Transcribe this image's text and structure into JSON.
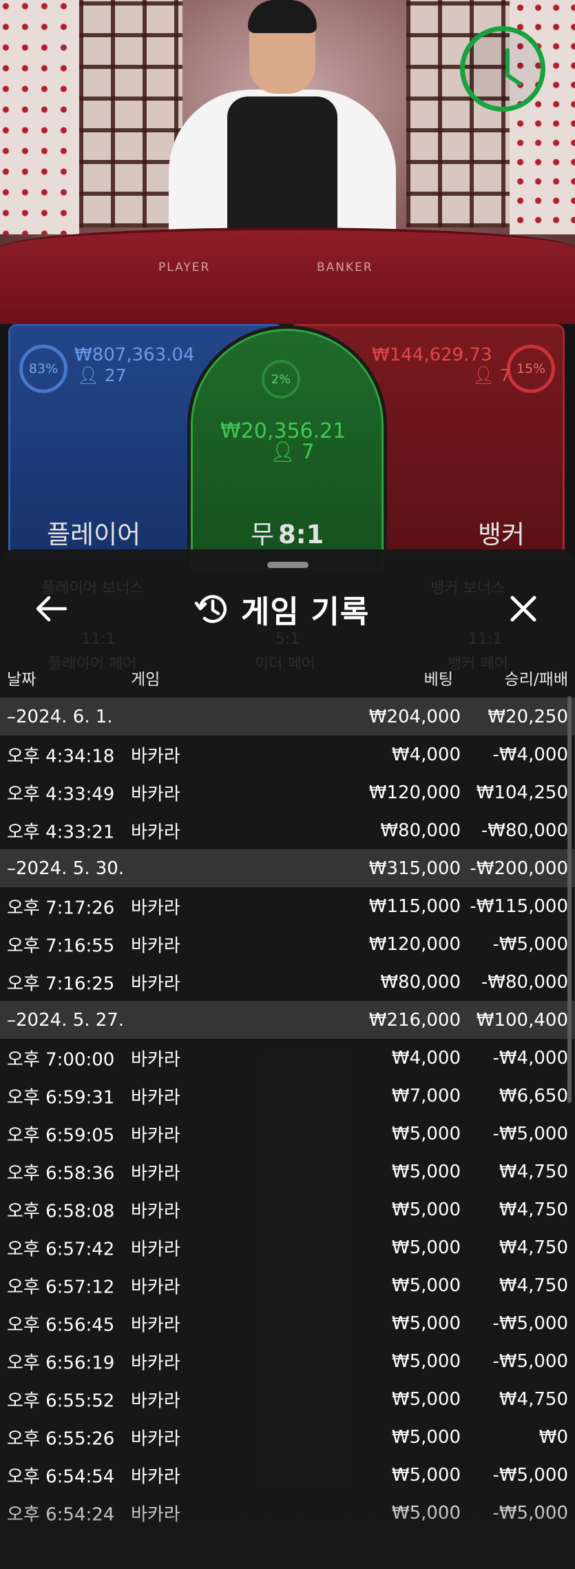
{
  "game": {
    "felt_player": "PLAYER",
    "felt_banker": "BANKER",
    "player": {
      "percent": "83%",
      "amount": "₩807,363.04",
      "count": "27",
      "label": "플레이어"
    },
    "tie": {
      "percent": "2%",
      "amount": "₩20,356.21",
      "count": "7",
      "label": "무",
      "payout": "8:1"
    },
    "banker": {
      "percent": "15%",
      "amount": "₩144,629.73",
      "count": "7",
      "label": "뱅커"
    },
    "timer_progress": 1.0,
    "colors": {
      "player": "#2d5bb0",
      "tie": "#2fa53f",
      "banker": "#a8262e",
      "timer": "#17a23f"
    }
  },
  "background_ghost": {
    "player_bonus": "플레이어 보너스",
    "either_pair": "이더 페어",
    "banker_bonus": "뱅커 보너스",
    "player_pair": "플레이어 페어",
    "banker_pair": "뱅커 페어",
    "odds_11a": "11:1",
    "odds_5": "5:1",
    "odds_11b": "11:1"
  },
  "history": {
    "title": "게임 기록",
    "icons": {
      "back": "back-arrow-icon",
      "history": "history-clock-icon",
      "close": "close-icon"
    },
    "columns": {
      "date": "날짜",
      "game": "게임",
      "bet": "베팅",
      "result": "승리/패배"
    },
    "rows": [
      {
        "type": "group",
        "date": "–2024. 6. 1.",
        "bet": "₩204,000",
        "result": "₩20,250"
      },
      {
        "type": "item",
        "time": "오후 4:34:18",
        "game": "바카라",
        "bet": "₩4,000",
        "result": "-₩4,000"
      },
      {
        "type": "item",
        "time": "오후 4:33:49",
        "game": "바카라",
        "bet": "₩120,000",
        "result": "₩104,250"
      },
      {
        "type": "item",
        "time": "오후 4:33:21",
        "game": "바카라",
        "bet": "₩80,000",
        "result": "-₩80,000"
      },
      {
        "type": "group",
        "date": "–2024. 5. 30.",
        "bet": "₩315,000",
        "result": "-₩200,000"
      },
      {
        "type": "item",
        "time": "오후 7:17:26",
        "game": "바카라",
        "bet": "₩115,000",
        "result": "-₩115,000"
      },
      {
        "type": "item",
        "time": "오후 7:16:55",
        "game": "바카라",
        "bet": "₩120,000",
        "result": "-₩5,000"
      },
      {
        "type": "item",
        "time": "오후 7:16:25",
        "game": "바카라",
        "bet": "₩80,000",
        "result": "-₩80,000"
      },
      {
        "type": "group",
        "date": "–2024. 5. 27.",
        "bet": "₩216,000",
        "result": "₩100,400"
      },
      {
        "type": "item",
        "time": "오후 7:00:00",
        "game": "바카라",
        "bet": "₩4,000",
        "result": "-₩4,000"
      },
      {
        "type": "item",
        "time": "오후 6:59:31",
        "game": "바카라",
        "bet": "₩7,000",
        "result": "₩6,650"
      },
      {
        "type": "item",
        "time": "오후 6:59:05",
        "game": "바카라",
        "bet": "₩5,000",
        "result": "-₩5,000"
      },
      {
        "type": "item",
        "time": "오후 6:58:36",
        "game": "바카라",
        "bet": "₩5,000",
        "result": "₩4,750"
      },
      {
        "type": "item",
        "time": "오후 6:58:08",
        "game": "바카라",
        "bet": "₩5,000",
        "result": "₩4,750"
      },
      {
        "type": "item",
        "time": "오후 6:57:42",
        "game": "바카라",
        "bet": "₩5,000",
        "result": "₩4,750"
      },
      {
        "type": "item",
        "time": "오후 6:57:12",
        "game": "바카라",
        "bet": "₩5,000",
        "result": "₩4,750"
      },
      {
        "type": "item",
        "time": "오후 6:56:45",
        "game": "바카라",
        "bet": "₩5,000",
        "result": "-₩5,000"
      },
      {
        "type": "item",
        "time": "오후 6:56:19",
        "game": "바카라",
        "bet": "₩5,000",
        "result": "-₩5,000"
      },
      {
        "type": "item",
        "time": "오후 6:55:52",
        "game": "바카라",
        "bet": "₩5,000",
        "result": "₩4,750"
      },
      {
        "type": "item",
        "time": "오후 6:55:26",
        "game": "바카라",
        "bet": "₩5,000",
        "result": "₩0"
      },
      {
        "type": "item",
        "time": "오후 6:54:54",
        "game": "바카라",
        "bet": "₩5,000",
        "result": "-₩5,000"
      },
      {
        "type": "item",
        "time": "오후 6:54:24",
        "game": "바카라",
        "bet": "₩5,000",
        "result": "-₩5,000"
      }
    ]
  }
}
